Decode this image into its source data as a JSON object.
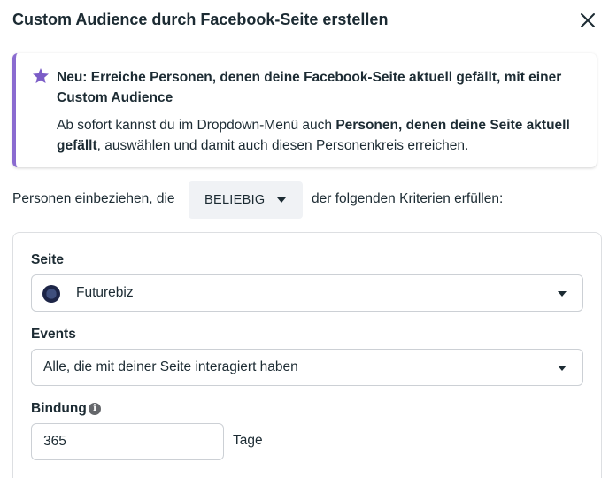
{
  "dialog": {
    "title": "Custom Audience durch Facebook-Seite erstellen"
  },
  "notice": {
    "title": "Neu: Erreiche Personen, denen deine Facebook-Seite aktuell gefällt, mit einer Custom Audience",
    "body_intro": "Ab sofort kannst du im Dropdown-Menü auch ",
    "body_bold": "Personen, denen deine Seite aktuell gefällt",
    "body_outro": ", auswählen und damit auch diesen Personenkreis erreichen.",
    "accent_color": "#8a6bd0",
    "icon": "star-icon"
  },
  "criteria": {
    "prefix": "Personen einbeziehen, die",
    "selected": "BELIEBIG",
    "suffix": "der folgenden Kriterien erfüllen:"
  },
  "rule": {
    "page_label": "Seite",
    "page_value": "Futurebiz",
    "events_label": "Events",
    "events_value": "Alle, die mit deiner Seite interagiert haben",
    "retention_label": "Bindung",
    "retention_value": "365",
    "retention_unit": "Tage"
  }
}
